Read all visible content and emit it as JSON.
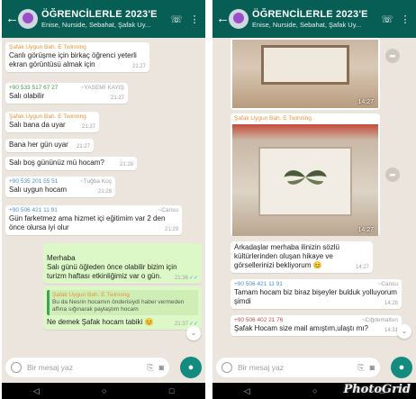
{
  "left": {
    "header": {
      "title": "ÖĞRENCİLERLE 2023'E",
      "subtitle": "Enise, Nurside, Sebahat, Şafak Uy..."
    },
    "messages": [
      {
        "sender": "Şafak Uygun Bah. E Twinning",
        "text": "Canlı görüşme için birkaç öğrenci yeterli ekran görüntüsü almak için",
        "time": "21:27"
      },
      {
        "sender": "+90 533 517 67 27",
        "alias": "~YASEMİ KAYIŞ",
        "text": "Salı olabilir",
        "time": "21:27"
      },
      {
        "sender": "Şafak Uygun Bah. E Twinning",
        "text": "Salı bana da uyar",
        "time": "21:27"
      },
      {
        "text": "Bana her gün uyar",
        "time": "21:27"
      },
      {
        "text": "Salı boş gününüz mü hocam?",
        "time": "21:28"
      },
      {
        "sender": "+90 535 201 55 51",
        "alias": "~Tuğba Koç",
        "text": "Salı uygun hocam",
        "time": "21:28"
      },
      {
        "sender": "+90 506 421 11 91",
        "alias": "~Cansu",
        "text": "Gün farketmez ama hizmet içi eğitimim var 2 den önce olursa iyi olur",
        "time": "21:29"
      },
      {
        "text": "Merhaba\nSalı günü öğleden önce olabilir bizim için turizm haftası etkinliğimiz var o gün.",
        "time": "21:36"
      },
      {
        "quote_name": "Şafak Uygun Bah. E Twinning",
        "quote_text": "Bu da Nesrin hocamın önderisiydi haber vermeden affına sığınarak paylaştım hocam",
        "text": "Ne demek Şafak hocam tabiki",
        "emoji": "😊",
        "time": "21:37"
      }
    ],
    "input_placeholder": "Bir mesaj yaz"
  },
  "right": {
    "header": {
      "title": "ÖĞRENCİLERLE 2023'E",
      "subtitle": "Enise, Nurside, Sebahat, Şafak Uy..."
    },
    "images": [
      {
        "time": "14:27"
      },
      {
        "sender": "Şafak Uygun Bah. E Twinning",
        "time": "14:27"
      }
    ],
    "messages": [
      {
        "text": "Arkadaşlar merhaba ilinizin sözlü kültürlerinden oluşan hikaye ve görsellerinizi bekliyorum",
        "emoji": "😊",
        "time": "14:27"
      },
      {
        "sender": "+90 506 421 11 91",
        "alias": "~Cansu",
        "text": "Tamam hocam biz biraz bişeyler bulduk yolluyorum şimdi",
        "time": "14:28"
      },
      {
        "sender": "+90 506 402 21 76",
        "alias": "~Ciğdemaltun",
        "text": "Şafak Hocam size mail amıştım,ulaştı mı?",
        "time": "14:31"
      }
    ],
    "input_placeholder": "Bir mesaj yaz"
  },
  "watermark": "PhotoGrid",
  "colors": {
    "header": "#075e54",
    "chat_bg": "#ece5dd",
    "outgoing": "#dcf8c6",
    "incoming": "#ffffff",
    "mic": "#128c7e"
  },
  "icons": [
    "back-arrow-icon",
    "video-call-icon",
    "menu-dots-icon",
    "emoji-icon",
    "attach-icon",
    "camera-icon",
    "mic-icon",
    "share-icon",
    "nav-back-icon",
    "nav-home-icon",
    "nav-recents-icon"
  ]
}
